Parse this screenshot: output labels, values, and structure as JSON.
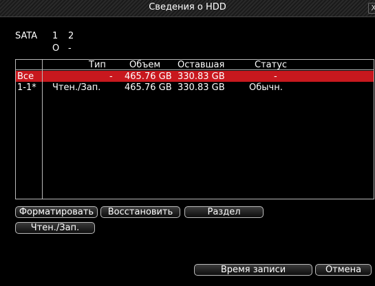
{
  "window": {
    "title": "Сведения о HDD",
    "close_glyph": "X"
  },
  "sata": {
    "label": "SATA",
    "ports": [
      "1",
      "2"
    ],
    "status": [
      "O",
      "-"
    ]
  },
  "table": {
    "headers": [
      "Тип",
      "Объем",
      "Оставшая",
      "Статус"
    ],
    "rows": [
      {
        "id": "Все",
        "type": "-",
        "size": "465.76 GB",
        "remaining": "330.83 GB",
        "status": "-",
        "selected": true
      },
      {
        "id": "1-1*",
        "type": "Чтен./Зап.",
        "size": "465.76 GB",
        "remaining": "330.83 GB",
        "status": "Обычн.",
        "selected": false
      }
    ]
  },
  "buttons": {
    "format": "Форматировать",
    "restore": "Восстановить",
    "partition": "Раздел",
    "readwrite": "Чтен./Зап.",
    "record_time": "Время записи",
    "cancel": "Отмена"
  },
  "colors": {
    "selected_row": "#c8181e",
    "background": "#000000",
    "text": "#ffffff"
  }
}
